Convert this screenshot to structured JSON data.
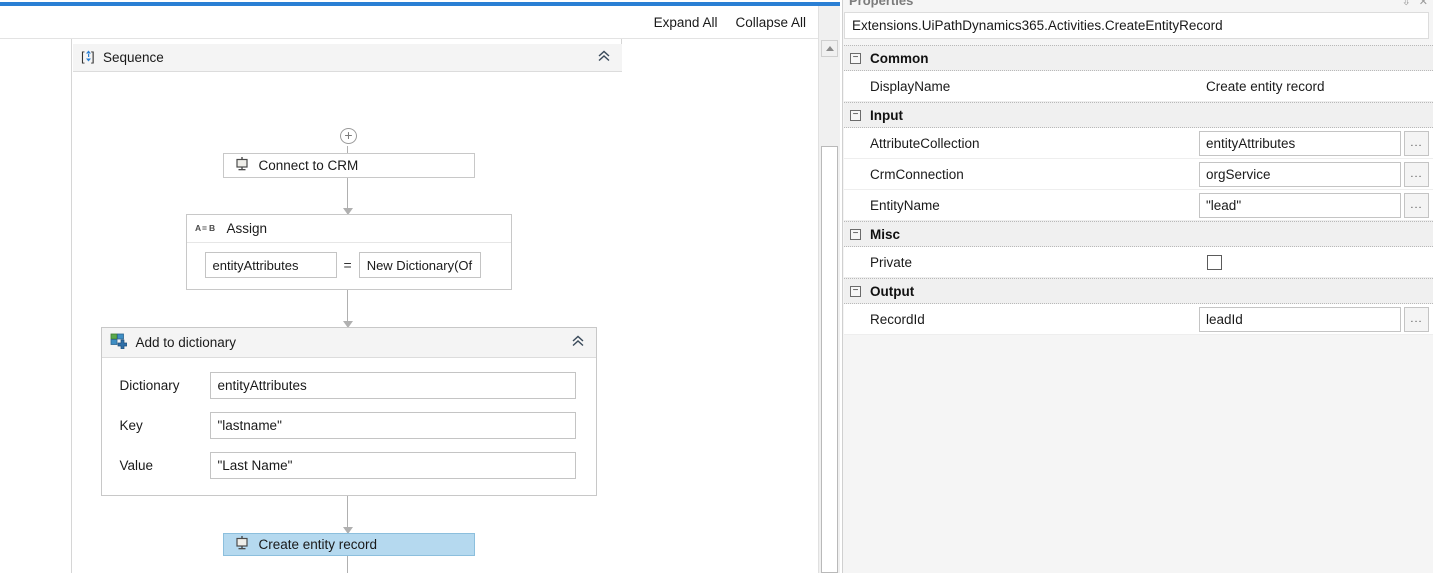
{
  "designer": {
    "toolbar": {
      "expand_all": "Expand All",
      "collapse_all": "Collapse All"
    },
    "sequence": {
      "title": "Sequence",
      "icon": "sequence-icon"
    },
    "activities": {
      "connect_to_crm": {
        "label": "Connect to CRM",
        "icon": "crm-activity-icon"
      },
      "assign": {
        "title": "Assign",
        "icon": "assign-icon",
        "left_expression": "entityAttributes",
        "operator": "=",
        "right_expression": "New Dictionary(Of"
      },
      "add_to_dictionary": {
        "title": "Add to dictionary",
        "icon": "add-to-dictionary-icon",
        "fields": [
          {
            "label": "Dictionary",
            "value": "entityAttributes"
          },
          {
            "label": "Key",
            "value": "\"lastname\""
          },
          {
            "label": "Value",
            "value": "\"Last Name\""
          }
        ]
      },
      "create_entity_record": {
        "label": "Create entity record",
        "icon": "crm-activity-icon",
        "selected": true
      }
    }
  },
  "properties": {
    "panel_title": "Properties",
    "activity_type": "Extensions.UiPathDynamics365.Activities.CreateEntityRecord",
    "categories": [
      {
        "name": "Common",
        "expander": "−",
        "rows": [
          {
            "name": "DisplayName",
            "value": "Create entity record",
            "editor": "plain"
          }
        ]
      },
      {
        "name": "Input",
        "expander": "−",
        "rows": [
          {
            "name": "AttributeCollection",
            "value": "entityAttributes",
            "editor": "expression",
            "browse": "..."
          },
          {
            "name": "CrmConnection",
            "value": "orgService",
            "editor": "expression",
            "browse": "..."
          },
          {
            "name": "EntityName",
            "value": "\"lead\"",
            "editor": "expression",
            "browse": "..."
          }
        ]
      },
      {
        "name": "Misc",
        "expander": "−",
        "rows": [
          {
            "name": "Private",
            "value": "",
            "editor": "checkbox",
            "checked": false
          }
        ]
      },
      {
        "name": "Output",
        "expander": "−",
        "rows": [
          {
            "name": "RecordId",
            "value": "leadId",
            "editor": "expression",
            "browse": "..."
          }
        ]
      }
    ]
  },
  "colors": {
    "accent_blue": "#2a7fd4",
    "selection_blue": "#b5d9ef",
    "panel_gray": "#f5f5f5",
    "header_gray": "#f4f4f4"
  }
}
